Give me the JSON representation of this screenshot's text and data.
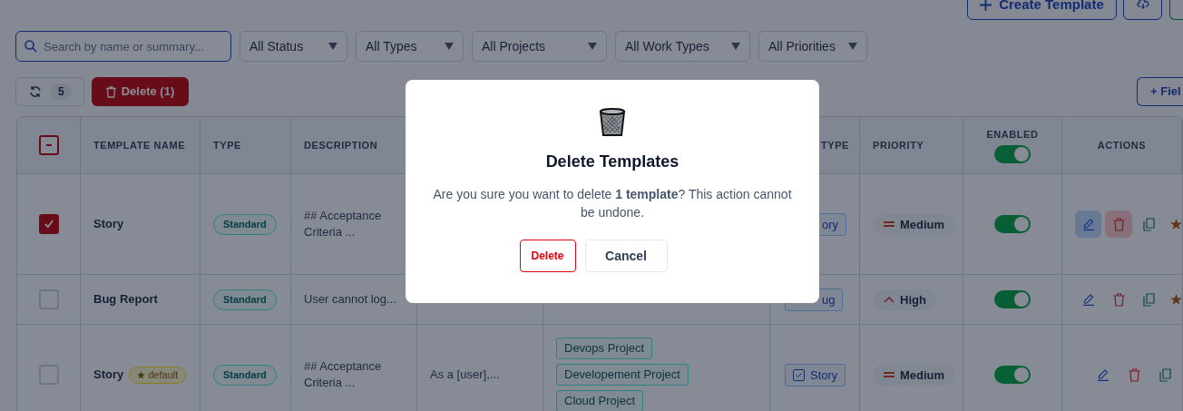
{
  "toolbar": {
    "create_button": "Create Template",
    "field_button": "+ Fiel"
  },
  "search": {
    "placeholder": "Search by name or summary..."
  },
  "filters": [
    "All Status",
    "All Types",
    "All Projects",
    "All Work Types",
    "All Priorities"
  ],
  "refresh": {
    "count": "5"
  },
  "bulk_delete": "Delete (1)",
  "table": {
    "select_all": {
      "partial": true
    },
    "columns": [
      {
        "label": "TEMPLATE NAME"
      },
      {
        "label": "TYPE"
      },
      {
        "label": "DESCRIPTION"
      },
      {},
      {},
      {
        "label": "TYPE"
      },
      {
        "label": "PRIORITY"
      },
      {
        "label": "ENABLED",
        "toggle_on": true
      },
      {
        "label": "ACTIONS"
      }
    ],
    "rows": [
      {
        "selected": true,
        "name": "Story",
        "type": "Standard",
        "description": "## Acceptance Criteria ...",
        "work_type": {
          "label": "ory",
          "partial": true
        },
        "priority": {
          "label": "Medium",
          "kind": "medium"
        },
        "enabled": true,
        "hovered": true,
        "can_set_default": true
      },
      {
        "selected": false,
        "name": "Bug Report",
        "type": "Standard",
        "description": "User cannot log...",
        "work_type": {
          "label": "ug",
          "partial": true
        },
        "priority": {
          "label": "High",
          "kind": "high"
        },
        "enabled": true,
        "hovered": false,
        "can_set_default": true
      },
      {
        "selected": false,
        "name": "Story",
        "badge": "default",
        "type": "Standard",
        "description": "## Acceptance Criteria ...",
        "summary": "As a [user],...",
        "projects": [
          "Devops Project",
          "Developement Project",
          "Cloud Project"
        ],
        "work_type": {
          "label": "Story",
          "partial": false
        },
        "priority": {
          "label": "Medium",
          "kind": "medium"
        },
        "enabled": true,
        "hovered": false,
        "can_set_default": false
      }
    ]
  },
  "dialog": {
    "title": "Delete Templates",
    "message": "Are you sure you want to delete **1 template**? This action cannot be undone.",
    "confirm": "Delete",
    "cancel": "Cancel"
  }
}
